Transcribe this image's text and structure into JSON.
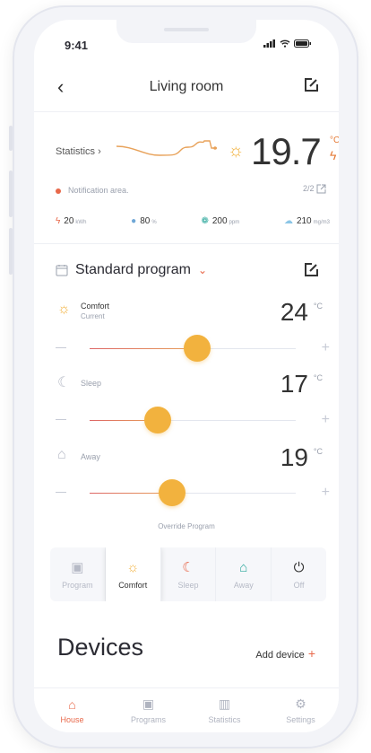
{
  "status": {
    "time": "9:41"
  },
  "header": {
    "title": "Living room",
    "back_icon": "chevron-left-icon",
    "edit_icon": "edit-icon"
  },
  "stats": {
    "label": "Statistics",
    "temperature": "19.7",
    "unit": "°C",
    "notification": "Notification area.",
    "page": "2/2",
    "metrics": [
      {
        "icon": "bolt-icon",
        "value": "20",
        "unit": "kWh"
      },
      {
        "icon": "drop-icon",
        "value": "80",
        "unit": "%"
      },
      {
        "icon": "co2-icon",
        "value": "200",
        "unit": "ppm"
      },
      {
        "icon": "cloud-icon",
        "value": "210",
        "unit": "mg/m3"
      }
    ]
  },
  "program": {
    "title": "Standard program",
    "modes": [
      {
        "name": "Comfort",
        "sub": "Current",
        "temp": "24",
        "unit": "°C",
        "level": 0.52
      },
      {
        "name": "Sleep",
        "sub": "",
        "temp": "17",
        "unit": "°C",
        "level": 0.33
      },
      {
        "name": "Away",
        "sub": "",
        "temp": "19",
        "unit": "°C",
        "level": 0.4
      }
    ],
    "override": "Override Program",
    "tabs": [
      "Program",
      "Comfort",
      "Sleep",
      "Away",
      "Off"
    ],
    "active_tab": "Comfort"
  },
  "devices": {
    "title": "Devices",
    "add_label": "Add device",
    "add_symbol": "+"
  },
  "tabbar": {
    "items": [
      "House",
      "Programs",
      "Statistics",
      "Settings"
    ],
    "active": "House"
  },
  "colors": {
    "accent": "#e8684a",
    "sun": "#f2b23e"
  }
}
